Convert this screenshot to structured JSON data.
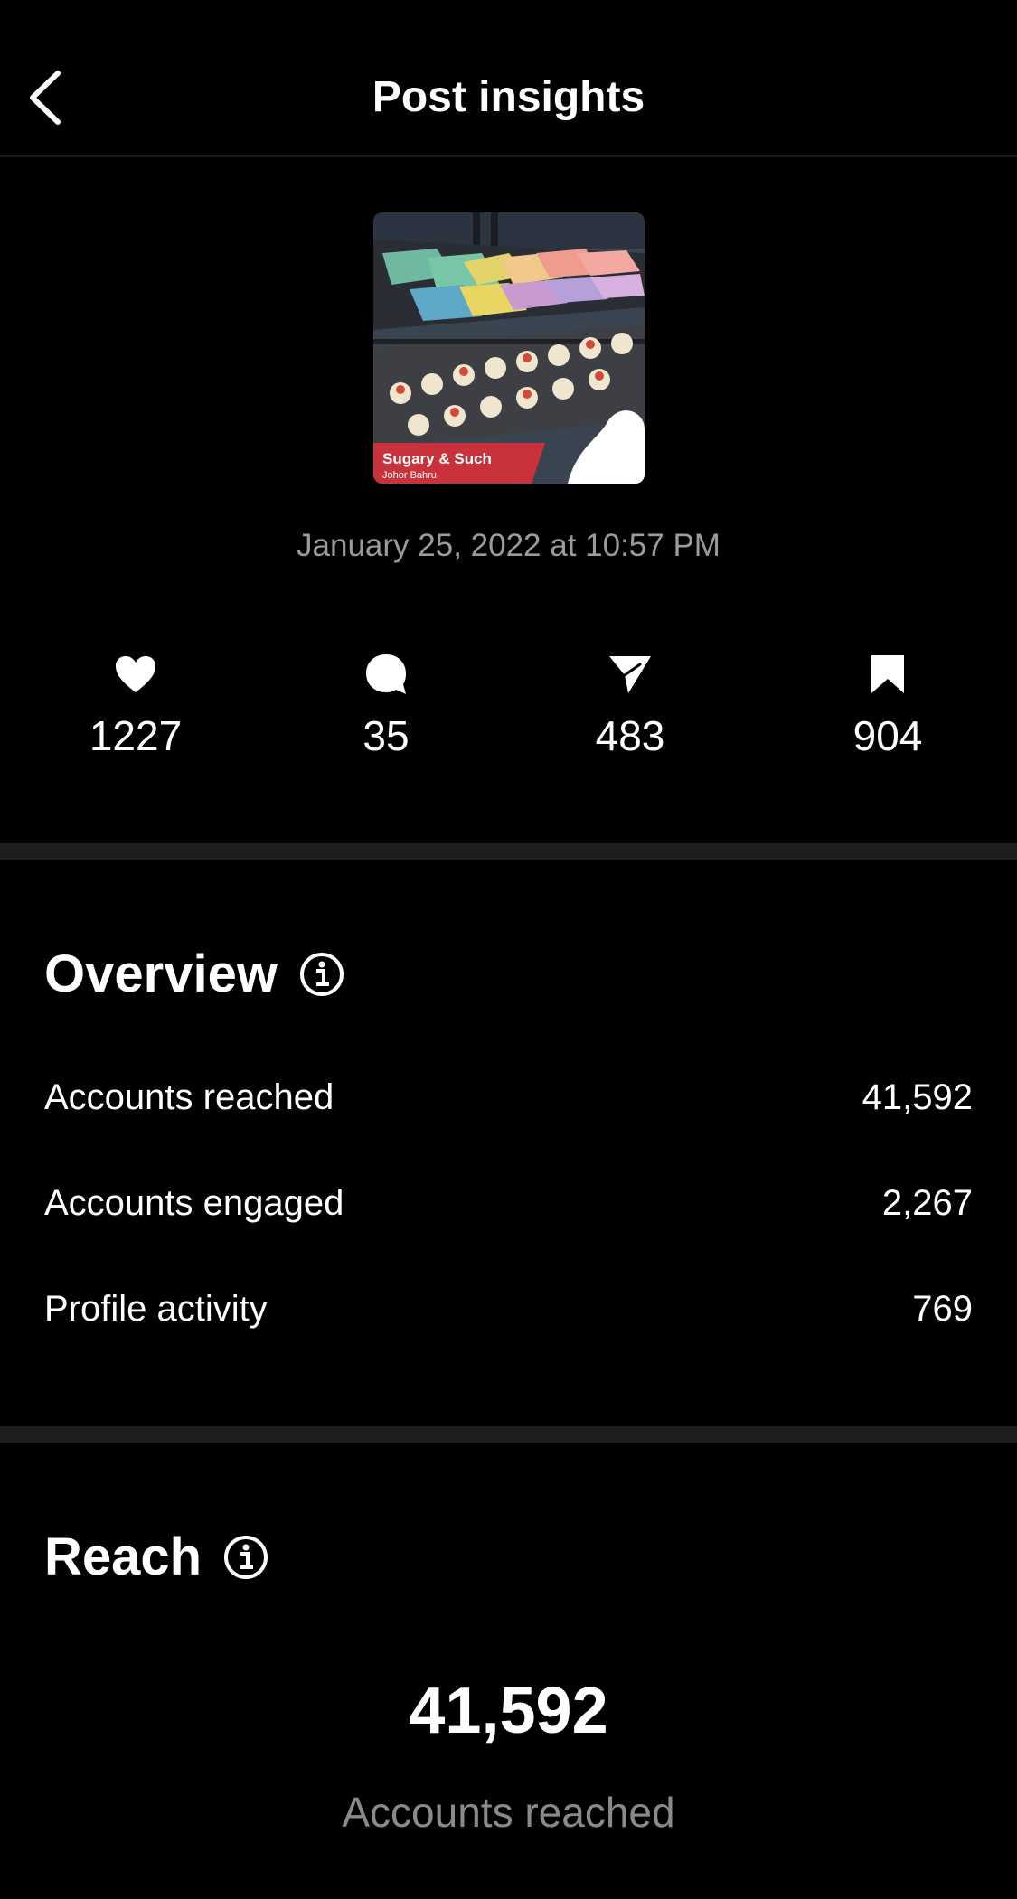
{
  "header": {
    "title": "Post insights"
  },
  "post": {
    "thumbnail_caption": "Sugary & Such",
    "thumbnail_subcaption": "Johor Bahru",
    "date": "January 25, 2022 at 10:57 PM"
  },
  "stats": {
    "likes": "1227",
    "comments": "35",
    "shares": "483",
    "saves": "904"
  },
  "overview": {
    "title": "Overview",
    "rows": [
      {
        "label": "Accounts reached",
        "value": "41,592"
      },
      {
        "label": "Accounts engaged",
        "value": "2,267"
      },
      {
        "label": "Profile activity",
        "value": "769"
      }
    ]
  },
  "reach": {
    "title": "Reach",
    "value": "41,592",
    "label": "Accounts reached"
  }
}
